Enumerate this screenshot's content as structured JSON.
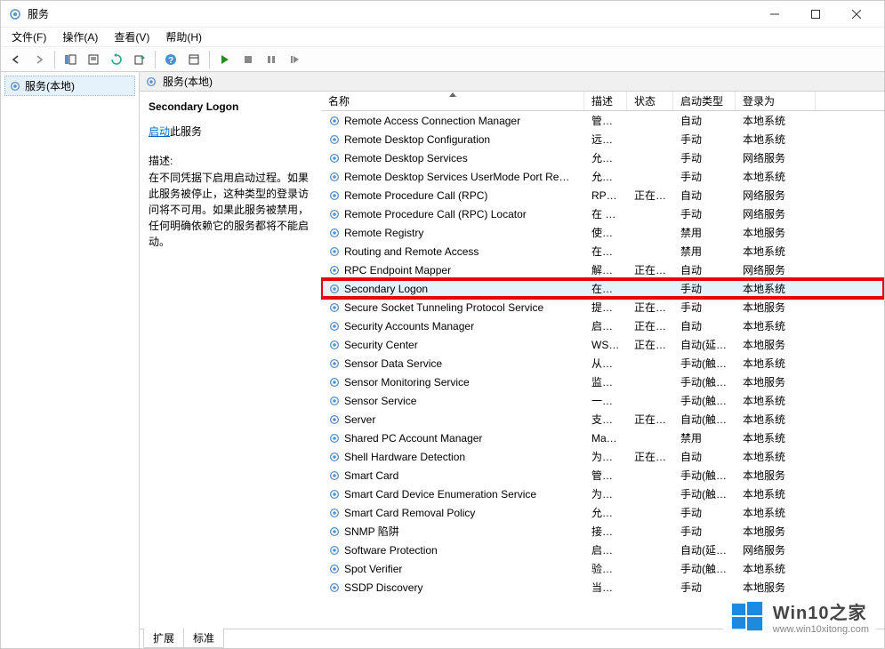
{
  "window": {
    "title": "服务"
  },
  "menu": {
    "file": "文件(F)",
    "action": "操作(A)",
    "view": "查看(V)",
    "help": "帮助(H)"
  },
  "left": {
    "root": "服务(本地)"
  },
  "rightHeader": "服务(本地)",
  "detail": {
    "title": "Secondary Logon",
    "action_link": "启动",
    "action_suffix": "此服务",
    "desc_label": "描述:",
    "desc_body": "在不同凭据下启用启动过程。如果此服务被停止，这种类型的登录访问将不可用。如果此服务被禁用，任何明确依赖它的服务都将不能启动。"
  },
  "columns": {
    "name": "名称",
    "desc": "描述",
    "status": "状态",
    "startup": "启动类型",
    "logon": "登录为"
  },
  "rows": [
    {
      "name": "Remote Access Connection Manager",
      "desc": "管理…",
      "status": "",
      "startup": "自动",
      "logon": "本地系统"
    },
    {
      "name": "Remote Desktop Configuration",
      "desc": "远程…",
      "status": "",
      "startup": "手动",
      "logon": "本地系统"
    },
    {
      "name": "Remote Desktop Services",
      "desc": "允许…",
      "status": "",
      "startup": "手动",
      "logon": "网络服务"
    },
    {
      "name": "Remote Desktop Services UserMode Port Re…",
      "desc": "允许…",
      "status": "",
      "startup": "手动",
      "logon": "本地系统"
    },
    {
      "name": "Remote Procedure Call (RPC)",
      "desc": "RPC…",
      "status": "正在…",
      "startup": "自动",
      "logon": "网络服务"
    },
    {
      "name": "Remote Procedure Call (RPC) Locator",
      "desc": "在 W…",
      "status": "",
      "startup": "手动",
      "logon": "网络服务"
    },
    {
      "name": "Remote Registry",
      "desc": "使远…",
      "status": "",
      "startup": "禁用",
      "logon": "本地服务"
    },
    {
      "name": "Routing and Remote Access",
      "desc": "在局…",
      "status": "",
      "startup": "禁用",
      "logon": "本地系统"
    },
    {
      "name": "RPC Endpoint Mapper",
      "desc": "解析 …",
      "status": "正在…",
      "startup": "自动",
      "logon": "网络服务"
    },
    {
      "name": "Secondary Logon",
      "desc": "在不…",
      "status": "",
      "startup": "手动",
      "logon": "本地系统",
      "highlighted": true
    },
    {
      "name": "Secure Socket Tunneling Protocol Service",
      "desc": "提供…",
      "status": "正在…",
      "startup": "手动",
      "logon": "本地服务"
    },
    {
      "name": "Security Accounts Manager",
      "desc": "启动…",
      "status": "正在…",
      "startup": "自动",
      "logon": "本地系统"
    },
    {
      "name": "Security Center",
      "desc": "WSC…",
      "status": "正在…",
      "startup": "自动(延迟…",
      "logon": "本地服务"
    },
    {
      "name": "Sensor Data Service",
      "desc": "从各…",
      "status": "",
      "startup": "手动(触发…",
      "logon": "本地系统"
    },
    {
      "name": "Sensor Monitoring Service",
      "desc": "监视…",
      "status": "",
      "startup": "手动(触发…",
      "logon": "本地服务"
    },
    {
      "name": "Sensor Service",
      "desc": "一项…",
      "status": "",
      "startup": "手动(触发…",
      "logon": "本地系统"
    },
    {
      "name": "Server",
      "desc": "支持…",
      "status": "正在…",
      "startup": "自动(触发…",
      "logon": "本地系统"
    },
    {
      "name": "Shared PC Account Manager",
      "desc": "Man…",
      "status": "",
      "startup": "禁用",
      "logon": "本地系统"
    },
    {
      "name": "Shell Hardware Detection",
      "desc": "为自…",
      "status": "正在…",
      "startup": "自动",
      "logon": "本地系统"
    },
    {
      "name": "Smart Card",
      "desc": "管理…",
      "status": "",
      "startup": "手动(触发…",
      "logon": "本地服务"
    },
    {
      "name": "Smart Card Device Enumeration Service",
      "desc": "为给…",
      "status": "",
      "startup": "手动(触发…",
      "logon": "本地系统"
    },
    {
      "name": "Smart Card Removal Policy",
      "desc": "允许…",
      "status": "",
      "startup": "手动",
      "logon": "本地系统"
    },
    {
      "name": "SNMP 陷阱",
      "desc": "接收…",
      "status": "",
      "startup": "手动",
      "logon": "本地服务"
    },
    {
      "name": "Software Protection",
      "desc": "启用 …",
      "status": "",
      "startup": "自动(延迟…",
      "logon": "网络服务"
    },
    {
      "name": "Spot Verifier",
      "desc": "验证…",
      "status": "",
      "startup": "手动(触发…",
      "logon": "本地系统"
    },
    {
      "name": "SSDP Discovery",
      "desc": "当发…",
      "status": "",
      "startup": "手动",
      "logon": "本地服务"
    }
  ],
  "tabs": {
    "extended": "扩展",
    "standard": "标准"
  },
  "watermark": {
    "title": "Win10之家",
    "url": "www.win10xitong.com"
  }
}
